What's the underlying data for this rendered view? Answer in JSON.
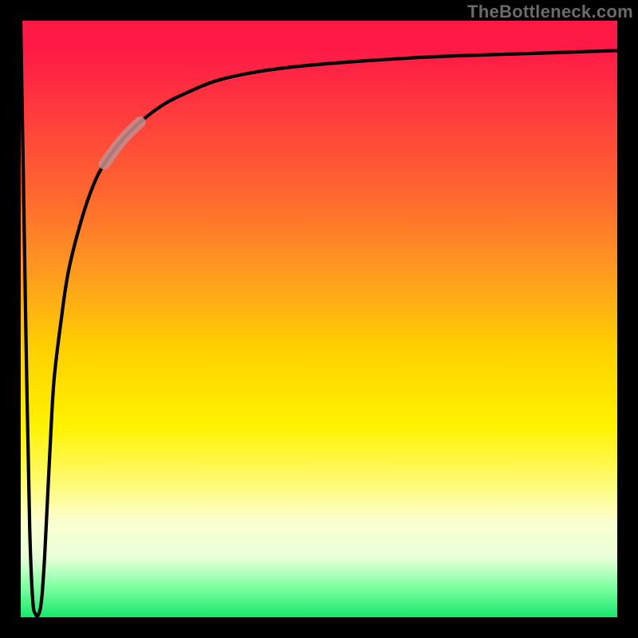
{
  "attribution": "TheBottleneck.com",
  "chart_data": {
    "type": "line",
    "title": "",
    "xlabel": "",
    "ylabel": "",
    "xlim": [
      0,
      100
    ],
    "ylim": [
      0,
      100
    ],
    "series": [
      {
        "name": "bottleneck-curve",
        "x": [
          0.0,
          0.5,
          1.0,
          1.5,
          2.0,
          2.5,
          3.0,
          3.5,
          4.0,
          4.5,
          5.0,
          5.6,
          6.8,
          8.0,
          10.0,
          12.0,
          14.0,
          17.0,
          20.0,
          24.0,
          28.0,
          33.0,
          40.0,
          48.0,
          58.0,
          70.0,
          85.0,
          100.0
        ],
        "y": [
          100.0,
          70.0,
          40.0,
          15.0,
          3.0,
          0.5,
          0.5,
          3.0,
          10.0,
          20.0,
          30.0,
          40.0,
          50.0,
          58.0,
          66.0,
          72.0,
          76.0,
          80.0,
          83.0,
          86.0,
          88.0,
          90.0,
          91.5,
          92.5,
          93.3,
          94.0,
          94.5,
          95.0
        ]
      }
    ],
    "highlight": {
      "x_start": 14.0,
      "x_end": 20.0,
      "color": "#c68e8e"
    }
  }
}
